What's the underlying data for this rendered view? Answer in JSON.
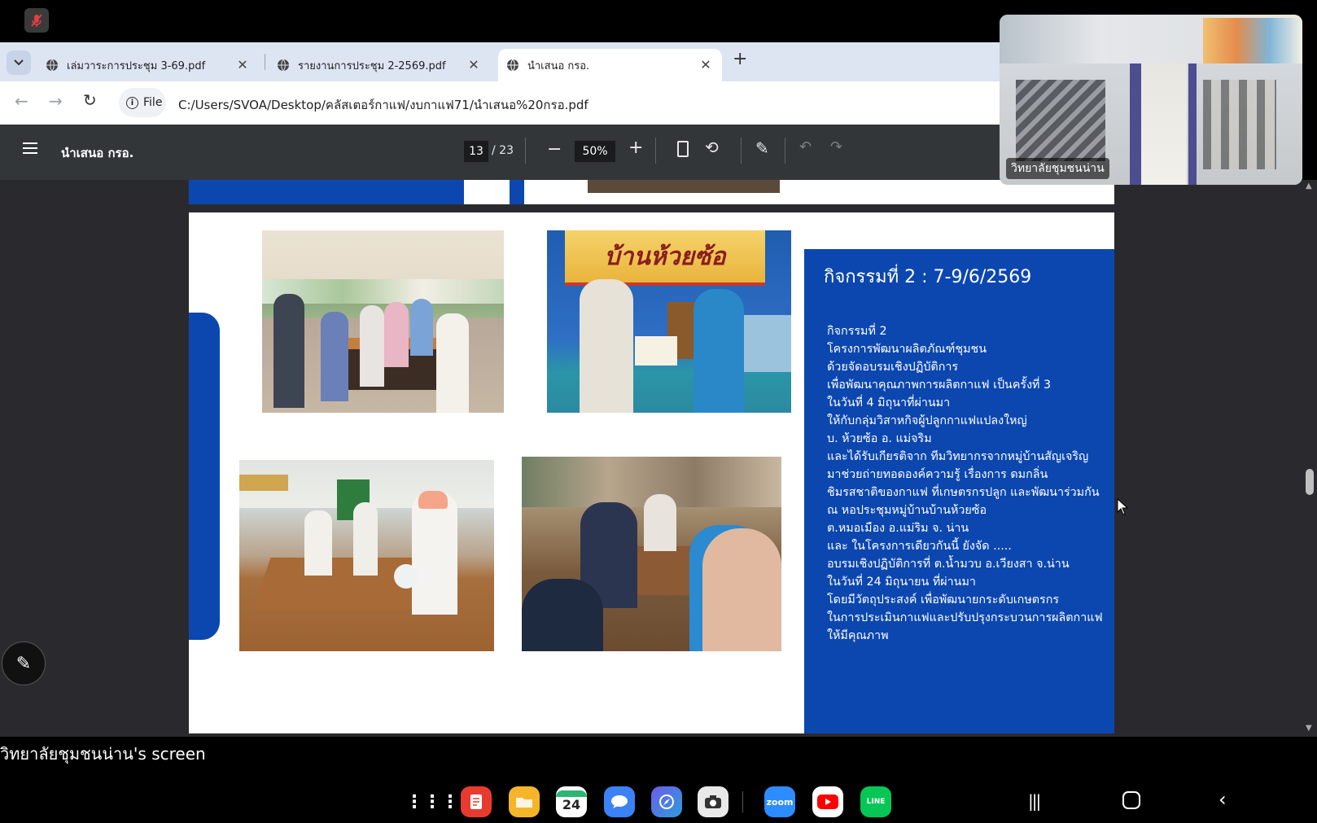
{
  "browser": {
    "tabs": [
      {
        "label": "เล่มวาระการประชุม 3-69.pdf"
      },
      {
        "label": "รายงานการประชุม 2-2569.pdf"
      },
      {
        "label": "นำเสนอ กรอ."
      }
    ],
    "address": {
      "scheme_label": "File",
      "url": "C:/Users/SVOA/Desktop/คลัสเตอร์กาแฟ/งบกาแฟ71/นำเสนอ%20กรอ.pdf"
    }
  },
  "pdf": {
    "title": "นำเสนอ กรอ.",
    "page_current": "13",
    "page_total": "/ 23",
    "zoom": "50%"
  },
  "slide": {
    "photo_banner": "บ้านห้วยซ้อ",
    "heading": "กิจกรรมที่ 2 : 7-9/6/2569",
    "lines": [
      "กิจกรรมที่ 2",
      "โครงการพัฒนาผลิตภัณฑ์ชุมชน",
      " ด้วยจัดอบรมเชิงปฏิบัติการ",
      "เพื่อพัฒนาคุณภาพการผลิตกาแฟ เป็นครั้งที่ 3",
      "ในวันที่ 4 มิถุนาที่ผ่านมา",
      "ให้กับกลุ่มวิสาหกิจผู้ปลูกกาแฟแปลงใหญ่",
      " บ. ห้วยซ้อ อ. แม่จริม",
      " และได้รับเกียรติจาก ทีมวิทยากรจากหมู่บ้านสัญเจริญ",
      "มาช่วยถ่ายทอดองค์ความรู้ เรื่องการ ดมกลิ่น",
      " ชิมรสชาติของกาแฟ ที่เกษตรกรปลูก และพัฒนาร่วมกัน",
      "ณ หอประชุมหมู่บ้านบ้านห้วยซ้อ",
      "ต.หมอเมือง อ.แม่ริม จ. น่าน",
      "     และ ในโครงการเดียวกันนี้ ยังจัด .....",
      "อบรมเชิงปฏิบัติการที่ ต.น้ำมวบ อ.เวียงสา จ.น่าน",
      "ในวันที่ 24 มิถุนายน ที่ผ่านมา",
      "โดยมีวัตถุประสงค์ เพื่อพัฒนายกระดับเกษตรกร",
      "ในการประเมินกาแฟและปรับปรุงกระบวนการผลิตกาแฟ",
      "ให้มีคุณภาพ"
    ]
  },
  "video": {
    "participant_name": "วิทยาลัยชุมชนน่าน"
  },
  "screen_caption": "วิทยาลัยชุมชนน่าน's screen",
  "dock": {
    "apps": [
      {
        "icon": "apps-grid-icon"
      },
      {
        "icon": "notes-icon"
      },
      {
        "icon": "files-icon"
      },
      {
        "icon": "calendar-icon",
        "label": "24"
      },
      {
        "icon": "messages-icon"
      },
      {
        "icon": "browser-icon"
      },
      {
        "icon": "camera-icon"
      },
      {
        "icon": "zoom-icon",
        "label": "zoom"
      },
      {
        "icon": "youtube-icon"
      },
      {
        "icon": "line-icon",
        "label": "LINE"
      }
    ]
  },
  "colors": {
    "slide_blue": "#0c47b0",
    "tabbar": "#dde5f3",
    "pdf_toolbar": "#323639"
  }
}
